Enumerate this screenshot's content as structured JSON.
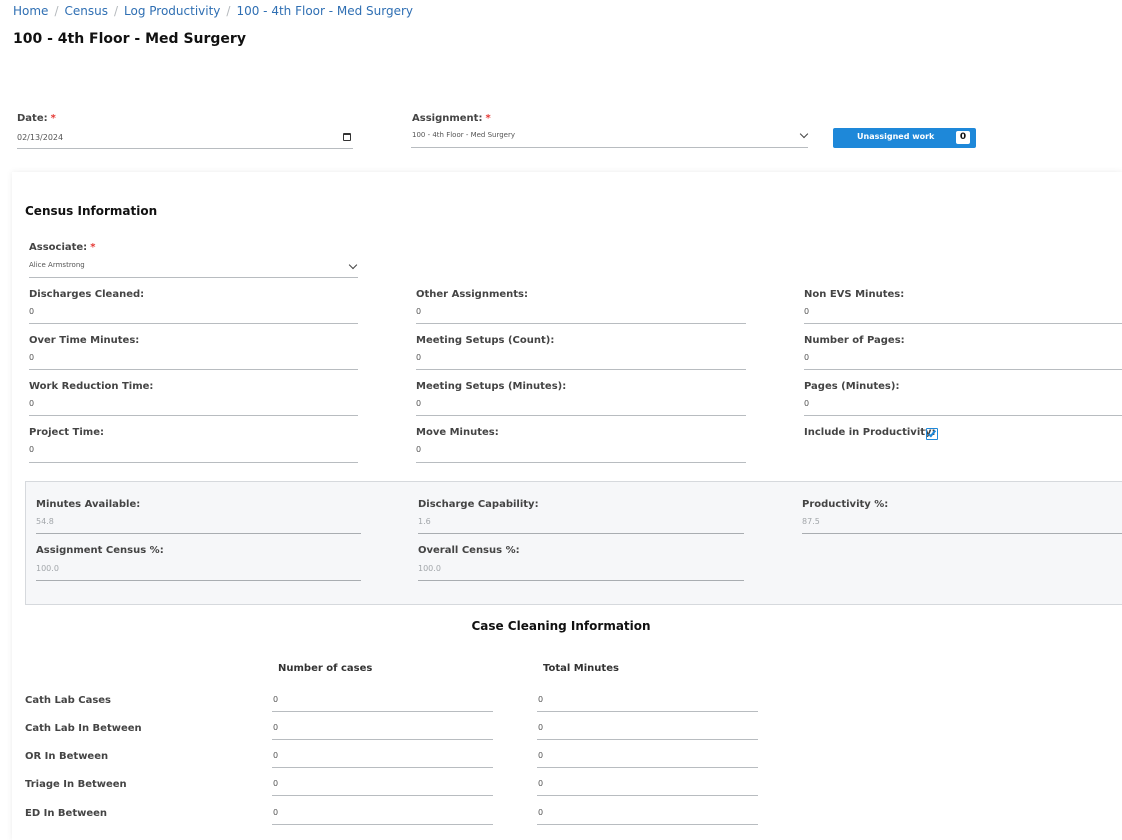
{
  "breadcrumb": [
    "Home",
    "Census",
    "Log Productivity",
    "100 - 4th Floor - Med Surgery"
  ],
  "page_title": "100 - 4th Floor - Med Surgery",
  "date": {
    "label": "Date:",
    "value": "02/13/2024"
  },
  "assignment": {
    "label": "Assignment:",
    "value": "100 - 4th Floor - Med Surgery"
  },
  "unassigned": {
    "label": "Unassigned work",
    "count": "0"
  },
  "census": {
    "title": "Census Information",
    "associate": {
      "label": "Associate:",
      "value": "Alice Armstrong"
    },
    "fields": [
      {
        "label": "Discharges Cleaned:",
        "value": "0"
      },
      {
        "label": "Other Assignments:",
        "value": "0"
      },
      {
        "label": "Non EVS Minutes:",
        "value": "0"
      },
      {
        "label": "Over Time Minutes:",
        "value": "0"
      },
      {
        "label": "Meeting Setups (Count):",
        "value": "0"
      },
      {
        "label": "Number of Pages:",
        "value": "0"
      },
      {
        "label": "Work Reduction Time:",
        "value": "0"
      },
      {
        "label": "Meeting Setups (Minutes):",
        "value": "0"
      },
      {
        "label": "Pages (Minutes):",
        "value": "0"
      },
      {
        "label": "Project Time:",
        "value": "0"
      },
      {
        "label": "Move Minutes:",
        "value": "0"
      },
      {
        "label": "Include in Productivity:",
        "checked": true
      }
    ]
  },
  "summary": [
    {
      "label": "Minutes Available:",
      "value": "54.8"
    },
    {
      "label": "Discharge Capability:",
      "value": "1.6"
    },
    {
      "label": "Productivity %:",
      "value": "87.5"
    },
    {
      "label": "Assignment Census %:",
      "value": "100.0"
    },
    {
      "label": "Overall Census %:",
      "value": "100.0"
    }
  ],
  "case_cleaning": {
    "title": "Case Cleaning Information",
    "col_cases": "Number of cases",
    "col_minutes": "Total Minutes",
    "rows": [
      {
        "label": "Cath Lab Cases",
        "cases": "0",
        "minutes": "0"
      },
      {
        "label": "Cath Lab In Between",
        "cases": "0",
        "minutes": "0"
      },
      {
        "label": "OR In Between",
        "cases": "0",
        "minutes": "0"
      },
      {
        "label": "Triage In Between",
        "cases": "0",
        "minutes": "0"
      },
      {
        "label": "ED In Between",
        "cases": "0",
        "minutes": "0"
      }
    ]
  },
  "colors": {
    "accent": "#1e88d9",
    "link": "#2f6fb3",
    "required": "#e53935",
    "panel": "#f6f7f9"
  }
}
